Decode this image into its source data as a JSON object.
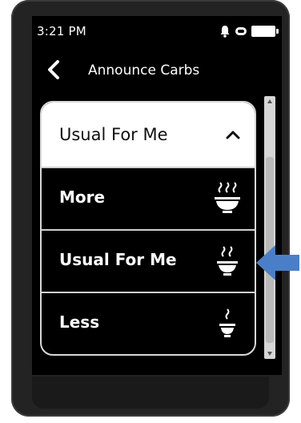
{
  "status_bar": {
    "time": "3:21 PM",
    "icons": [
      "bell-icon",
      "loop-icon",
      "battery-icon"
    ]
  },
  "header": {
    "back_icon": "chevron-left-icon",
    "title": "Announce Carbs"
  },
  "dropdown": {
    "selected_label": "Usual For Me",
    "expanded_icon": "chevron-up-icon",
    "options": [
      {
        "label": "More",
        "icon": "bowl-three-steam-icon"
      },
      {
        "label": "Usual For Me",
        "icon": "bowl-two-steam-icon"
      },
      {
        "label": "Less",
        "icon": "bowl-one-steam-icon"
      }
    ]
  },
  "annotation": {
    "arrow_icon": "arrow-left-icon",
    "arrow_color": "#4a7fc8"
  },
  "colors": {
    "screen_bg": "#000000",
    "header_bg": "#ffffff",
    "text_light": "#ffffff",
    "text_dark": "#111111",
    "divider": "#d0d0d0"
  }
}
